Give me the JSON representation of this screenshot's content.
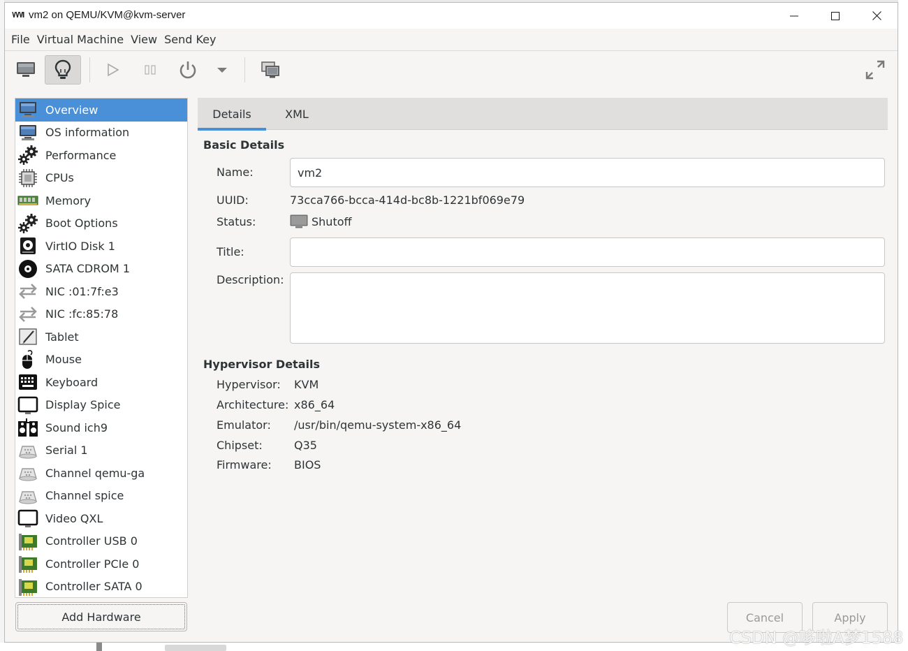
{
  "window": {
    "title": "vm2 on QEMU/KVM@kvm-server"
  },
  "menubar": {
    "items": [
      "File",
      "Virtual Machine",
      "View",
      "Send Key"
    ]
  },
  "toolbar": {
    "buttons": [
      {
        "icon": "monitor-icon",
        "active": false
      },
      {
        "icon": "lightbulb-icon",
        "active": true
      },
      {
        "icon": "play-icon",
        "active": false
      },
      {
        "icon": "pause-icon",
        "active": false
      },
      {
        "icon": "power-icon",
        "active": false
      },
      {
        "icon": "dropdown-arrow-icon",
        "active": false
      },
      {
        "icon": "screenshot-icon",
        "active": false
      },
      {
        "icon": "fullscreen-icon",
        "active": false
      }
    ]
  },
  "hardware": {
    "items": [
      {
        "label": "Overview",
        "icon": "monitor-icon",
        "selected": true
      },
      {
        "label": "OS information",
        "icon": "monitor-icon"
      },
      {
        "label": "Performance",
        "icon": "gears-icon"
      },
      {
        "label": "CPUs",
        "icon": "chip-icon"
      },
      {
        "label": "Memory",
        "icon": "ram-icon"
      },
      {
        "label": "Boot Options",
        "icon": "gears-icon"
      },
      {
        "label": "VirtIO Disk 1",
        "icon": "disk-icon"
      },
      {
        "label": "SATA CDROM 1",
        "icon": "cdrom-icon"
      },
      {
        "label": "NIC :01:7f:e3",
        "icon": "network-arrows-icon"
      },
      {
        "label": "NIC :fc:85:78",
        "icon": "network-arrows-icon"
      },
      {
        "label": "Tablet",
        "icon": "tablet-icon"
      },
      {
        "label": "Mouse",
        "icon": "mouse-icon"
      },
      {
        "label": "Keyboard",
        "icon": "keyboard-icon"
      },
      {
        "label": "Display Spice",
        "icon": "display-icon"
      },
      {
        "label": "Sound ich9",
        "icon": "sound-icon"
      },
      {
        "label": "Serial 1",
        "icon": "serial-icon"
      },
      {
        "label": "Channel qemu-ga",
        "icon": "serial-icon"
      },
      {
        "label": "Channel spice",
        "icon": "serial-icon"
      },
      {
        "label": "Video QXL",
        "icon": "display-icon"
      },
      {
        "label": "Controller USB 0",
        "icon": "pci-card-icon"
      },
      {
        "label": "Controller PCIe 0",
        "icon": "pci-card-icon"
      },
      {
        "label": "Controller SATA 0",
        "icon": "pci-card-icon"
      }
    ],
    "add_label": "Add Hardware"
  },
  "tabs": {
    "details": "Details",
    "xml": "XML",
    "active": "details"
  },
  "basic": {
    "heading": "Basic Details",
    "name_label": "Name:",
    "name_value": "vm2",
    "uuid_label": "UUID:",
    "uuid_value": "73cca766-bcca-414d-bc8b-1221bf069e79",
    "status_label": "Status:",
    "status_value": "Shutoff",
    "title_label": "Title:",
    "title_value": "",
    "description_label": "Description:",
    "description_value": ""
  },
  "hypervisor": {
    "heading": "Hypervisor Details",
    "hypervisor_label": "Hypervisor:",
    "hypervisor_value": "KVM",
    "architecture_label": "Architecture:",
    "architecture_value": "x86_64",
    "emulator_label": "Emulator:",
    "emulator_value": "/usr/bin/qemu-system-x86_64",
    "chipset_label": "Chipset:",
    "chipset_value": "Q35",
    "firmware_label": "Firmware:",
    "firmware_value": "BIOS"
  },
  "actions": {
    "cancel": "Cancel",
    "apply": "Apply"
  },
  "watermark": "CSDN @哆啦A梦1588",
  "colors": {
    "selection": "#4a90d9",
    "window_bg": "#f6f5f4",
    "disabled_text": "#9a9996"
  }
}
